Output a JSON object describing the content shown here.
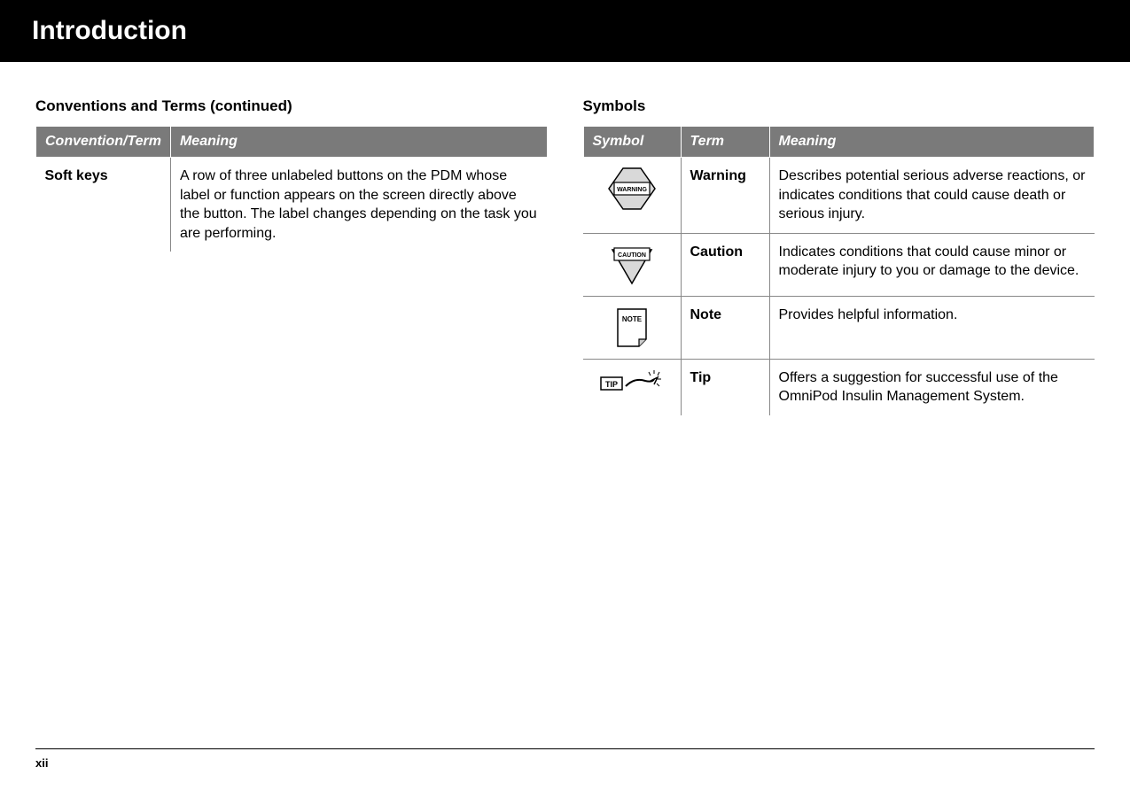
{
  "header": {
    "title": "Introduction"
  },
  "left": {
    "heading": "Conventions and Terms (continued)",
    "th1": "Convention/Term",
    "th2": "Meaning",
    "row": {
      "term": "Soft keys",
      "meaning": "A row of three unlabeled buttons on the PDM whose label or function appears on the screen directly above the button. The label changes depending on the task you are performing."
    }
  },
  "right": {
    "heading": "Symbols",
    "th1": "Symbol",
    "th2": "Term",
    "th3": "Meaning",
    "rows": [
      {
        "term": "Warning",
        "meaning": "Describes potential serious adverse reactions, or indicates conditions that could cause death or serious injury."
      },
      {
        "term": "Caution",
        "meaning": "Indicates conditions that could cause minor or moderate injury to you or damage to the device."
      },
      {
        "term": "Note",
        "meaning": "Provides helpful information."
      },
      {
        "term": "Tip",
        "meaning": "Offers a suggestion for successful use of the OmniPod Insulin Management System."
      }
    ],
    "iconLabels": {
      "warning": "WARNING",
      "caution": "CAUTION",
      "note": "NOTE",
      "tip": "TIP"
    }
  },
  "footer": {
    "pageNumber": "xii"
  }
}
